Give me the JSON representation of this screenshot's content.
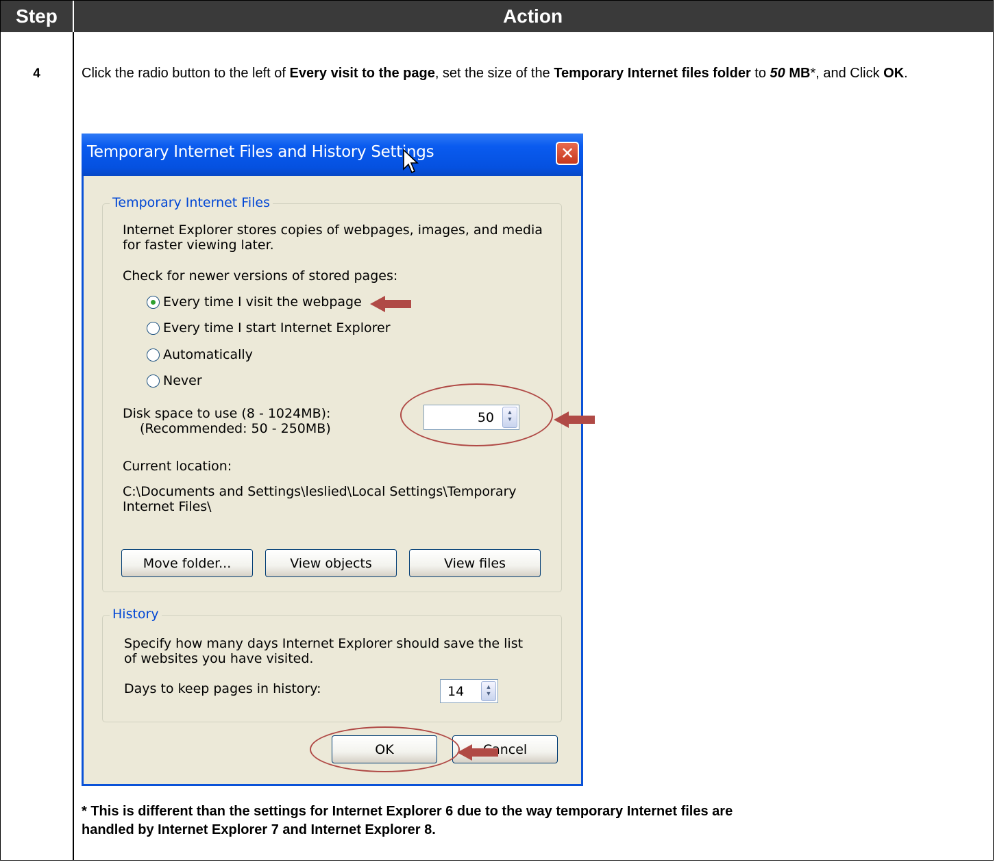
{
  "table": {
    "header_step": "Step",
    "header_action": "Action",
    "step_number": "4",
    "instruction": {
      "p1": "Click the radio button to the left of ",
      "b1": "Every visit to the page",
      "p2": ", set the size of the ",
      "b2": "Temporary Internet files folder",
      "p3": " to ",
      "b3_italic": "50",
      "b4": " MB",
      "p4": "*, and Click ",
      "b5": "OK",
      "p5": "."
    },
    "footnote_line1": "* This is different than the settings for Internet Explorer 6 due to the way temporary Internet files are",
    "footnote_line2": "handled by Internet Explorer 7 and Internet Explorer 8."
  },
  "dialog": {
    "title": "Temporary Internet Files and History Settings",
    "close_glyph": "✕",
    "tif_group": {
      "legend": "Temporary Internet Files",
      "desc_line1": "Internet Explorer stores copies of webpages, images, and media",
      "desc_line2": "for faster viewing later.",
      "check_label": "Check for newer versions of stored pages:",
      "options": [
        {
          "label": "Every time I visit the webpage",
          "selected": true
        },
        {
          "label": "Every time I start Internet Explorer",
          "selected": false
        },
        {
          "label": "Automatically",
          "selected": false
        },
        {
          "label": "Never",
          "selected": false
        }
      ],
      "disk_label": "Disk space to use (8 - 1024MB):",
      "disk_recommended": "(Recommended: 50 - 250MB)",
      "disk_value": "50",
      "location_label": "Current location:",
      "location_line1": "C:\\Documents and Settings\\leslied\\Local Settings\\Temporary",
      "location_line2": "Internet Files\\",
      "buttons": {
        "move": "Move folder...",
        "objects": "View objects",
        "files": "View files"
      }
    },
    "history_group": {
      "legend": "History",
      "desc_line1": "Specify how many days Internet Explorer should save the list",
      "desc_line2": "of websites you have visited.",
      "days_label": "Days to keep pages in history:",
      "days_value": "14"
    },
    "ok_label": "OK",
    "cancel_label": "Cancel"
  },
  "colors": {
    "annotation": "#b04a46",
    "header_bg": "#3a3a3a",
    "dialog_bg": "#ece9d8",
    "titlebar": "#0551e0",
    "legend_text": "#0046d5"
  }
}
